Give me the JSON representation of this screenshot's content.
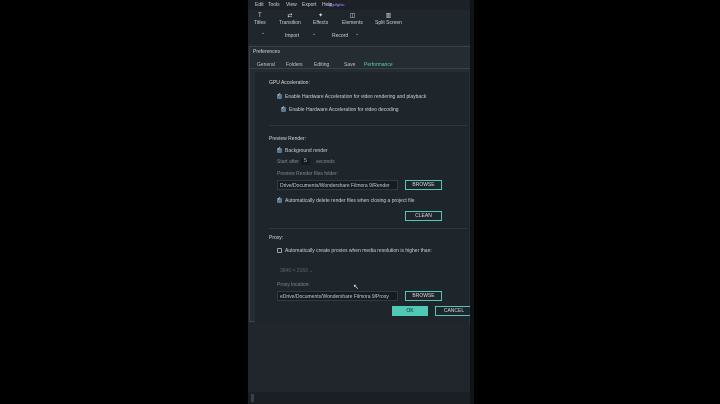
{
  "menubar": {
    "items": [
      "Edit",
      "Tools",
      "View",
      "Export",
      "Help"
    ],
    "badge": "dfgdfgfdc"
  },
  "toolbar": {
    "tools": [
      {
        "label": "Titles",
        "icon": "T"
      },
      {
        "label": "Transition",
        "icon": "⇄"
      },
      {
        "label": "Effects",
        "icon": "✦"
      },
      {
        "label": "Elements",
        "icon": "◫"
      },
      {
        "label": "Split Screen",
        "icon": "▥"
      }
    ],
    "import_label": "Import",
    "record_label": "Record"
  },
  "dialog": {
    "title": "Preferences",
    "tabs": [
      "General",
      "Folders",
      "Editing",
      "Save",
      "Performance"
    ],
    "active_tab": "Performance",
    "gpu": {
      "heading": "GPU Acceleration:",
      "render_label": "Enable Hardware Acceleration for video rendering and playback",
      "decode_label": "Enable Hardware Acceleration for video decoding"
    },
    "preview": {
      "heading": "Preview Render:",
      "background_label": "Background render",
      "start_after": "Start after",
      "seconds_value": "5",
      "seconds": "seconds",
      "folder_label": "Preview Render files folder:",
      "folder_path": "Drive/Documents/Wondershare Filmora 9/Render",
      "browse": "BROWSE",
      "auto_delete_label": "Automatically delete render files when closing a project file",
      "clean": "CLEAN"
    },
    "proxy": {
      "heading": "Proxy:",
      "auto_label": "Automatically create proxies when media resolution is higher than:",
      "resolution": "3840 × 2160",
      "location_label": "Proxy location:",
      "location_path": "eDrive/Documents/Wondershare Filmora 9/Proxy",
      "browse": "BROWSE"
    },
    "ok": "OK",
    "cancel": "CANCEL"
  },
  "colors": {
    "accent": "#4fc8b4",
    "background": "#232a30"
  }
}
